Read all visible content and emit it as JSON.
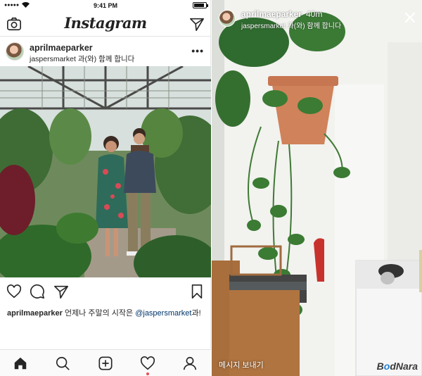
{
  "status_bar": {
    "time": "9:41 PM",
    "signal_dots": "●●●●●"
  },
  "feed": {
    "app_title": "Instagram",
    "post": {
      "username": "aprilmaeparker",
      "subtitle": "jaspersmarket 과(와) 함께 합니다",
      "more": "•••",
      "caption": {
        "username": "aprilmaeparker",
        "text": " 언제나 주말의 시작은 ",
        "mention": "@jaspersmarket",
        "suffix": "과!"
      }
    },
    "icons": {
      "camera": "camera-icon",
      "send": "send-icon",
      "like": "heart-icon",
      "comment": "comment-icon",
      "share": "share-icon",
      "save": "bookmark-icon"
    },
    "tab_bar": [
      "home-icon",
      "search-icon",
      "add-icon",
      "activity-icon",
      "profile-icon"
    ]
  },
  "story": {
    "username": "aprilmaeparker",
    "time": "40m",
    "subtitle": "jaspersmarket 과(와) 함께 합니다",
    "reply_label": "메시지 보내기",
    "close": "close-icon"
  },
  "watermark": {
    "prefix": "B",
    "o": "o",
    "suffix": "dNara"
  },
  "colors": {
    "text": "#262626",
    "mention": "#003569",
    "notification": "#ed4956",
    "border": "#e2e2e2"
  }
}
